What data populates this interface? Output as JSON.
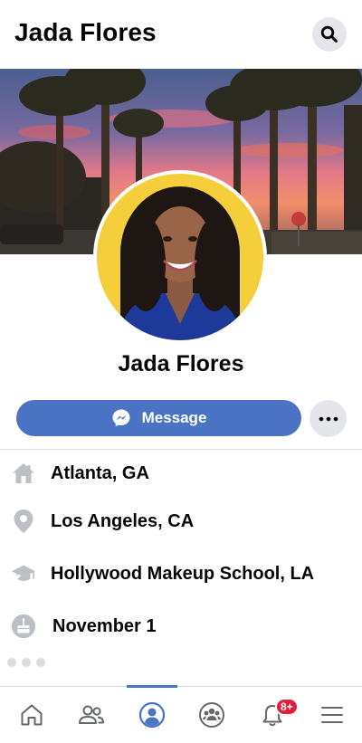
{
  "header": {
    "title": "Jada Flores",
    "search_icon": "search-icon"
  },
  "profile": {
    "name": "Jada Flores",
    "avatar_bg": "#f4cf3b"
  },
  "actions": {
    "message_label": "Message",
    "message_color": "#4b73c4",
    "more_icon": "more-horizontal-icon"
  },
  "info": [
    {
      "icon": "home-icon",
      "text": "Atlanta, GA"
    },
    {
      "icon": "location-pin-icon",
      "text": "Los Angeles, CA"
    },
    {
      "icon": "graduation-cap-icon",
      "text": "Hollywood Makeup School, LA"
    },
    {
      "icon": "birthday-cake-icon",
      "text": "November 1"
    }
  ],
  "tabbar": {
    "tabs": [
      {
        "name": "home",
        "icon": "home-outline-icon"
      },
      {
        "name": "friends",
        "icon": "friends-icon"
      },
      {
        "name": "profile",
        "icon": "profile-icon",
        "active": true
      },
      {
        "name": "groups",
        "icon": "groups-icon"
      },
      {
        "name": "notifications",
        "icon": "bell-icon",
        "badge": "8+"
      },
      {
        "name": "menu",
        "icon": "hamburger-menu-icon"
      }
    ],
    "notification_badge": "8+",
    "badge_color": "#e41e3f"
  }
}
